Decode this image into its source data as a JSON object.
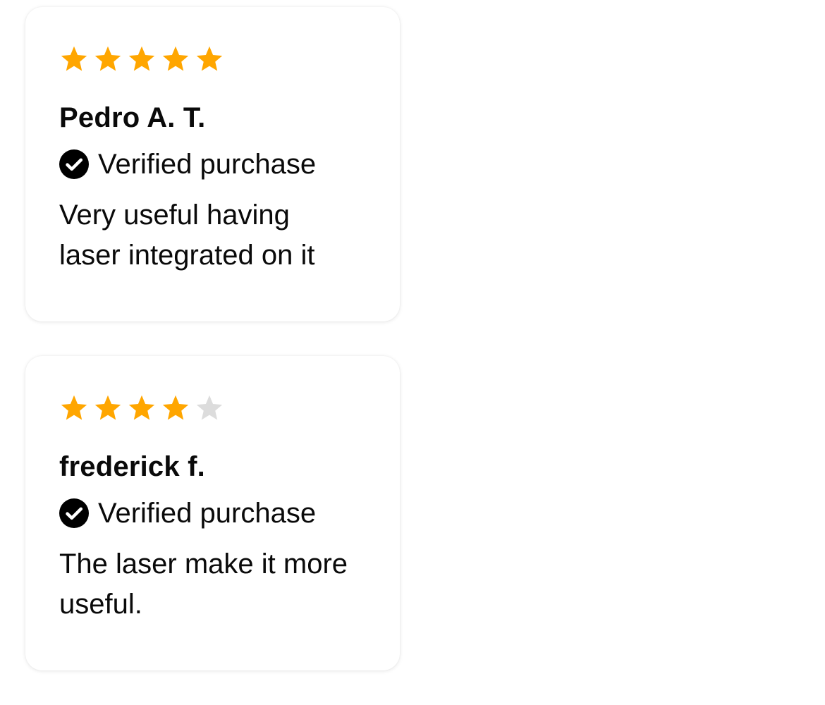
{
  "colors": {
    "star_filled": "#FFA600",
    "star_empty": "#DCDCDC",
    "check_circle": "#000000"
  },
  "reviews": [
    {
      "rating": 5,
      "max_rating": 5,
      "name": "Pedro A. T.",
      "verified_label": "Verified purchase",
      "verified_icon": "check-circle-icon",
      "text": "Very useful having laser integrated on it"
    },
    {
      "rating": 4,
      "max_rating": 5,
      "name": "frederick f.",
      "verified_label": "Verified purchase",
      "verified_icon": "check-circle-icon",
      "text": "The laser make it more useful."
    }
  ]
}
